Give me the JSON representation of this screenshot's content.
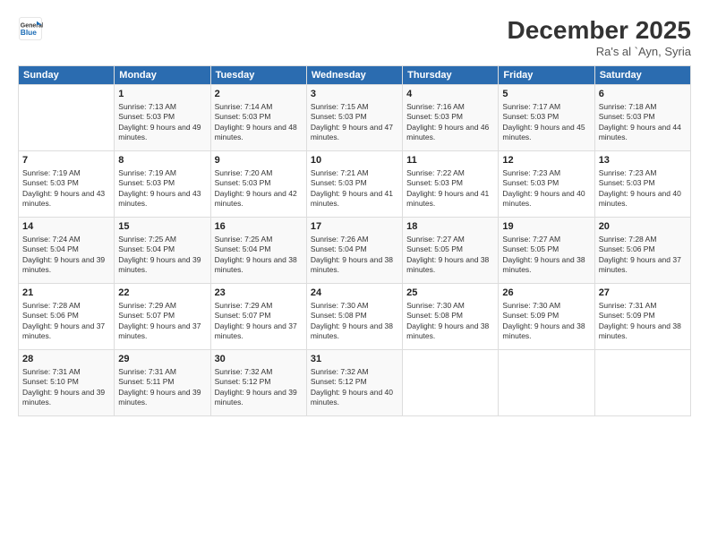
{
  "header": {
    "logo_line1": "General",
    "logo_line2": "Blue",
    "title": "December 2025",
    "location": "Ra's al `Ayn, Syria"
  },
  "days_of_week": [
    "Sunday",
    "Monday",
    "Tuesday",
    "Wednesday",
    "Thursday",
    "Friday",
    "Saturday"
  ],
  "weeks": [
    [
      {
        "day": "",
        "sunrise": "",
        "sunset": "",
        "daylight": ""
      },
      {
        "day": "1",
        "sunrise": "Sunrise: 7:13 AM",
        "sunset": "Sunset: 5:03 PM",
        "daylight": "Daylight: 9 hours and 49 minutes."
      },
      {
        "day": "2",
        "sunrise": "Sunrise: 7:14 AM",
        "sunset": "Sunset: 5:03 PM",
        "daylight": "Daylight: 9 hours and 48 minutes."
      },
      {
        "day": "3",
        "sunrise": "Sunrise: 7:15 AM",
        "sunset": "Sunset: 5:03 PM",
        "daylight": "Daylight: 9 hours and 47 minutes."
      },
      {
        "day": "4",
        "sunrise": "Sunrise: 7:16 AM",
        "sunset": "Sunset: 5:03 PM",
        "daylight": "Daylight: 9 hours and 46 minutes."
      },
      {
        "day": "5",
        "sunrise": "Sunrise: 7:17 AM",
        "sunset": "Sunset: 5:03 PM",
        "daylight": "Daylight: 9 hours and 45 minutes."
      },
      {
        "day": "6",
        "sunrise": "Sunrise: 7:18 AM",
        "sunset": "Sunset: 5:03 PM",
        "daylight": "Daylight: 9 hours and 44 minutes."
      }
    ],
    [
      {
        "day": "7",
        "sunrise": "Sunrise: 7:19 AM",
        "sunset": "Sunset: 5:03 PM",
        "daylight": "Daylight: 9 hours and 43 minutes."
      },
      {
        "day": "8",
        "sunrise": "Sunrise: 7:19 AM",
        "sunset": "Sunset: 5:03 PM",
        "daylight": "Daylight: 9 hours and 43 minutes."
      },
      {
        "day": "9",
        "sunrise": "Sunrise: 7:20 AM",
        "sunset": "Sunset: 5:03 PM",
        "daylight": "Daylight: 9 hours and 42 minutes."
      },
      {
        "day": "10",
        "sunrise": "Sunrise: 7:21 AM",
        "sunset": "Sunset: 5:03 PM",
        "daylight": "Daylight: 9 hours and 41 minutes."
      },
      {
        "day": "11",
        "sunrise": "Sunrise: 7:22 AM",
        "sunset": "Sunset: 5:03 PM",
        "daylight": "Daylight: 9 hours and 41 minutes."
      },
      {
        "day": "12",
        "sunrise": "Sunrise: 7:23 AM",
        "sunset": "Sunset: 5:03 PM",
        "daylight": "Daylight: 9 hours and 40 minutes."
      },
      {
        "day": "13",
        "sunrise": "Sunrise: 7:23 AM",
        "sunset": "Sunset: 5:03 PM",
        "daylight": "Daylight: 9 hours and 40 minutes."
      }
    ],
    [
      {
        "day": "14",
        "sunrise": "Sunrise: 7:24 AM",
        "sunset": "Sunset: 5:04 PM",
        "daylight": "Daylight: 9 hours and 39 minutes."
      },
      {
        "day": "15",
        "sunrise": "Sunrise: 7:25 AM",
        "sunset": "Sunset: 5:04 PM",
        "daylight": "Daylight: 9 hours and 39 minutes."
      },
      {
        "day": "16",
        "sunrise": "Sunrise: 7:25 AM",
        "sunset": "Sunset: 5:04 PM",
        "daylight": "Daylight: 9 hours and 38 minutes."
      },
      {
        "day": "17",
        "sunrise": "Sunrise: 7:26 AM",
        "sunset": "Sunset: 5:04 PM",
        "daylight": "Daylight: 9 hours and 38 minutes."
      },
      {
        "day": "18",
        "sunrise": "Sunrise: 7:27 AM",
        "sunset": "Sunset: 5:05 PM",
        "daylight": "Daylight: 9 hours and 38 minutes."
      },
      {
        "day": "19",
        "sunrise": "Sunrise: 7:27 AM",
        "sunset": "Sunset: 5:05 PM",
        "daylight": "Daylight: 9 hours and 38 minutes."
      },
      {
        "day": "20",
        "sunrise": "Sunrise: 7:28 AM",
        "sunset": "Sunset: 5:06 PM",
        "daylight": "Daylight: 9 hours and 37 minutes."
      }
    ],
    [
      {
        "day": "21",
        "sunrise": "Sunrise: 7:28 AM",
        "sunset": "Sunset: 5:06 PM",
        "daylight": "Daylight: 9 hours and 37 minutes."
      },
      {
        "day": "22",
        "sunrise": "Sunrise: 7:29 AM",
        "sunset": "Sunset: 5:07 PM",
        "daylight": "Daylight: 9 hours and 37 minutes."
      },
      {
        "day": "23",
        "sunrise": "Sunrise: 7:29 AM",
        "sunset": "Sunset: 5:07 PM",
        "daylight": "Daylight: 9 hours and 37 minutes."
      },
      {
        "day": "24",
        "sunrise": "Sunrise: 7:30 AM",
        "sunset": "Sunset: 5:08 PM",
        "daylight": "Daylight: 9 hours and 38 minutes."
      },
      {
        "day": "25",
        "sunrise": "Sunrise: 7:30 AM",
        "sunset": "Sunset: 5:08 PM",
        "daylight": "Daylight: 9 hours and 38 minutes."
      },
      {
        "day": "26",
        "sunrise": "Sunrise: 7:30 AM",
        "sunset": "Sunset: 5:09 PM",
        "daylight": "Daylight: 9 hours and 38 minutes."
      },
      {
        "day": "27",
        "sunrise": "Sunrise: 7:31 AM",
        "sunset": "Sunset: 5:09 PM",
        "daylight": "Daylight: 9 hours and 38 minutes."
      }
    ],
    [
      {
        "day": "28",
        "sunrise": "Sunrise: 7:31 AM",
        "sunset": "Sunset: 5:10 PM",
        "daylight": "Daylight: 9 hours and 39 minutes."
      },
      {
        "day": "29",
        "sunrise": "Sunrise: 7:31 AM",
        "sunset": "Sunset: 5:11 PM",
        "daylight": "Daylight: 9 hours and 39 minutes."
      },
      {
        "day": "30",
        "sunrise": "Sunrise: 7:32 AM",
        "sunset": "Sunset: 5:12 PM",
        "daylight": "Daylight: 9 hours and 39 minutes."
      },
      {
        "day": "31",
        "sunrise": "Sunrise: 7:32 AM",
        "sunset": "Sunset: 5:12 PM",
        "daylight": "Daylight: 9 hours and 40 minutes."
      },
      {
        "day": "",
        "sunrise": "",
        "sunset": "",
        "daylight": ""
      },
      {
        "day": "",
        "sunrise": "",
        "sunset": "",
        "daylight": ""
      },
      {
        "day": "",
        "sunrise": "",
        "sunset": "",
        "daylight": ""
      }
    ]
  ]
}
